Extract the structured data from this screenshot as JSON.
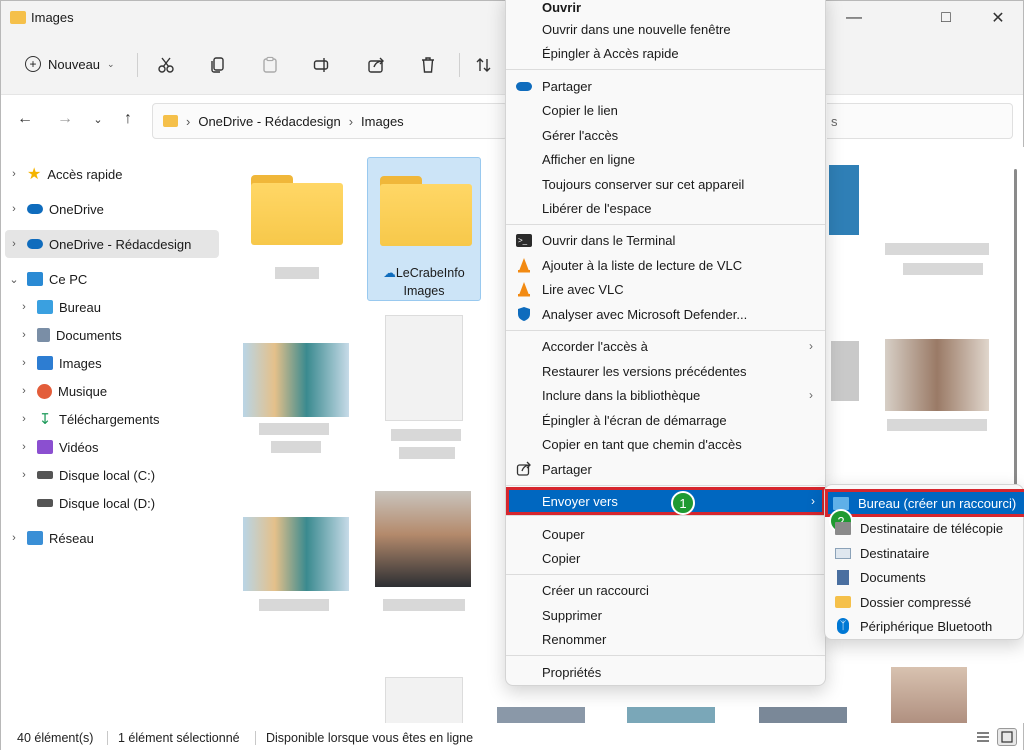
{
  "window": {
    "title": "Images"
  },
  "toolbar": {
    "new_label": "Nouveau"
  },
  "address": {
    "segments": [
      "OneDrive - Rédacdesign",
      "Images"
    ],
    "search_fragment": "s"
  },
  "sidebar": {
    "items": [
      {
        "label": "Accès rapide",
        "icon": "star-icon",
        "color": "#f5b400"
      },
      {
        "label": "OneDrive",
        "icon": "cloud-icon",
        "color": "#0f6cbd"
      },
      {
        "label": "OneDrive - Rédacdesign",
        "icon": "cloud-icon",
        "color": "#0f6cbd"
      },
      {
        "label": "Ce PC",
        "icon": "monitor-icon",
        "color": "#2a8ad4"
      },
      {
        "label": "Bureau",
        "icon": "desktop-icon",
        "color": "#3aa0e0"
      },
      {
        "label": "Documents",
        "icon": "document-icon",
        "color": "#7a8ea6"
      },
      {
        "label": "Images",
        "icon": "image-icon",
        "color": "#2d7dd2"
      },
      {
        "label": "Musique",
        "icon": "music-icon",
        "color": "#e35d3a"
      },
      {
        "label": "Téléchargements",
        "icon": "download-icon",
        "color": "#1e9a5a"
      },
      {
        "label": "Vidéos",
        "icon": "video-icon",
        "color": "#8b4fd0"
      },
      {
        "label": "Disque local (C:)",
        "icon": "drive-icon",
        "color": "#555555"
      },
      {
        "label": "Disque local (D:)",
        "icon": "drive-icon",
        "color": "#555555"
      },
      {
        "label": "Réseau",
        "icon": "network-icon",
        "color": "#3a8fd6"
      }
    ]
  },
  "content": {
    "selected_folder": {
      "line1": "LeCrabeInfo",
      "line2": "Images"
    }
  },
  "context_menu": {
    "items": [
      {
        "label": "Ouvrir"
      },
      {
        "label": "Ouvrir dans une nouvelle fenêtre"
      },
      {
        "label": "Épingler à Accès rapide"
      },
      {
        "label": "Partager",
        "icon": "onedrive-cloud-icon"
      },
      {
        "label": "Copier le lien"
      },
      {
        "label": "Gérer l'accès"
      },
      {
        "label": "Afficher en ligne"
      },
      {
        "label": "Toujours conserver sur cet appareil"
      },
      {
        "label": "Libérer de l'espace"
      },
      {
        "label": "Ouvrir dans le Terminal",
        "icon": "terminal-icon"
      },
      {
        "label": "Ajouter à la liste de lecture de VLC",
        "icon": "vlc-icon"
      },
      {
        "label": "Lire avec VLC",
        "icon": "vlc-icon"
      },
      {
        "label": "Analyser avec Microsoft Defender...",
        "icon": "defender-shield-icon"
      },
      {
        "label": "Accorder l'accès à"
      },
      {
        "label": "Restaurer les versions précédentes"
      },
      {
        "label": "Inclure dans la bibliothèque"
      },
      {
        "label": "Épingler à l'écran de démarrage"
      },
      {
        "label": "Copier en tant que chemin d'accès"
      },
      {
        "label": "Partager",
        "icon": "share-icon"
      },
      {
        "label": "Envoyer vers"
      },
      {
        "label": "Couper"
      },
      {
        "label": "Copier"
      },
      {
        "label": "Créer un raccourci"
      },
      {
        "label": "Supprimer"
      },
      {
        "label": "Renommer"
      },
      {
        "label": "Propriétés"
      }
    ],
    "badge1": "1"
  },
  "submenu": {
    "items": [
      {
        "label": "Bureau (créer un raccourci)",
        "icon": "desktop-icon"
      },
      {
        "label": "Destinataire de télécopie",
        "icon": "fax-icon"
      },
      {
        "label": "Destinataire",
        "icon": "mail-icon"
      },
      {
        "label": "Documents",
        "icon": "document-icon"
      },
      {
        "label": "Dossier compressé",
        "icon": "zip-folder-icon"
      },
      {
        "label": "Périphérique Bluetooth",
        "icon": "bluetooth-icon"
      }
    ],
    "badge2": "2"
  },
  "status": {
    "count": "40 élément(s)",
    "selection": "1 élément sélectionné",
    "availability": "Disponible lorsque vous êtes en ligne"
  },
  "colors": {
    "highlight": "#0067c0",
    "annotation_border": "#d6262e",
    "badge": "#1f9a31"
  }
}
